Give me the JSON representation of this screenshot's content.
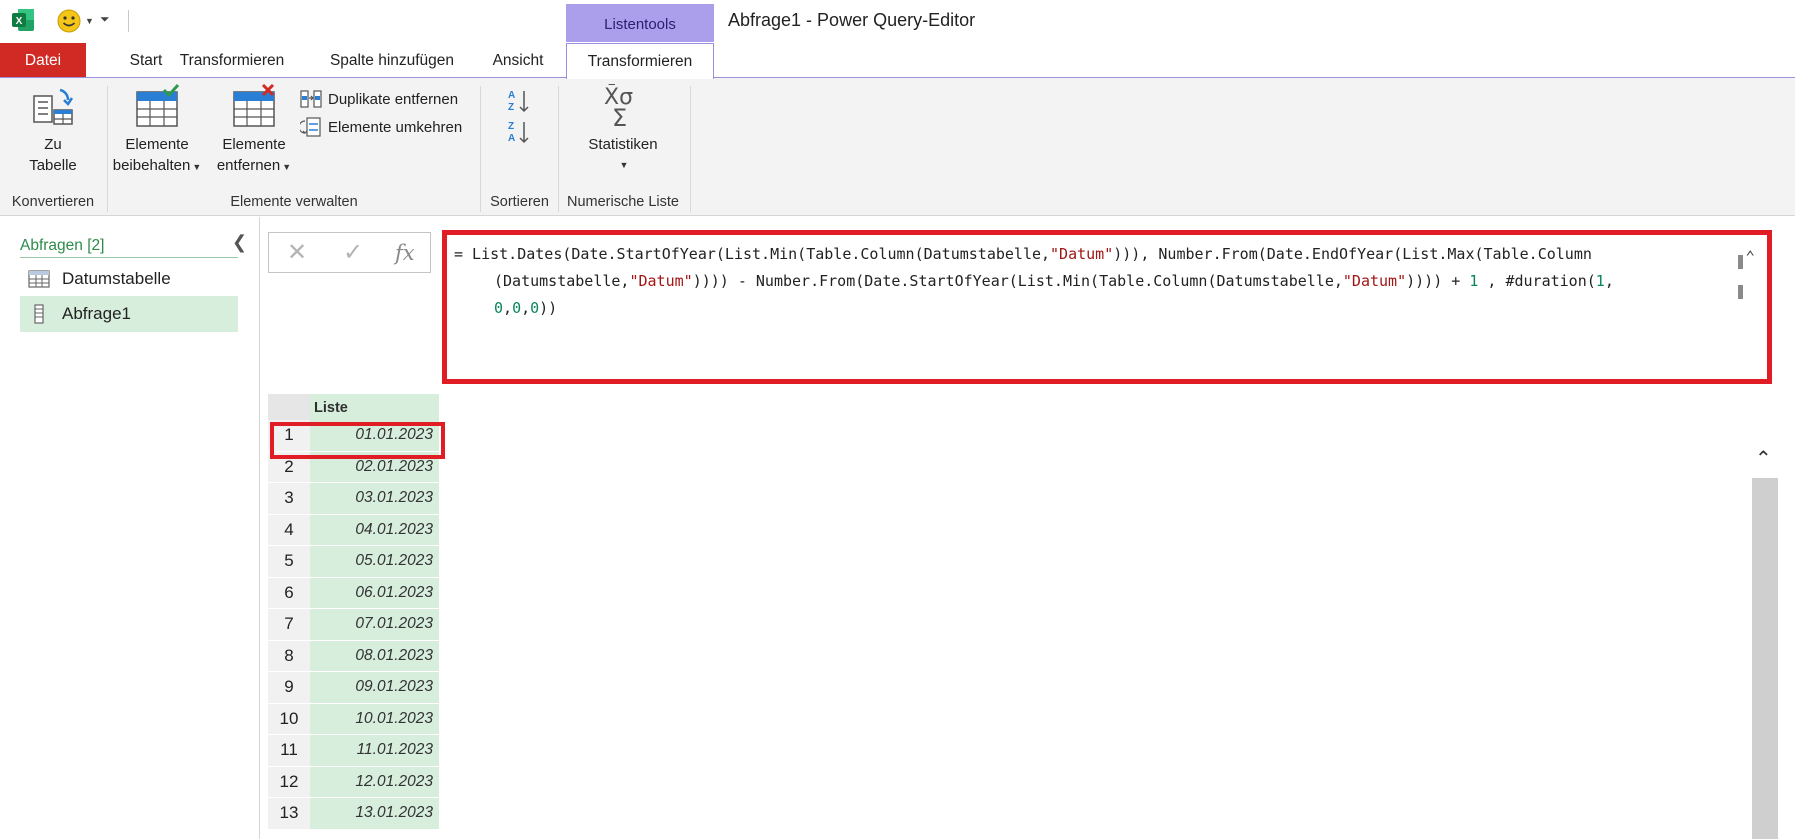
{
  "window": {
    "title": "Abfrage1 - Power Query-Editor",
    "context_group": "Listentools",
    "context_color": "#ab9eea"
  },
  "tabs": [
    {
      "label": "Datei"
    },
    {
      "label": "Start"
    },
    {
      "label": "Transformieren"
    },
    {
      "label": "Spalte hinzufügen"
    },
    {
      "label": "Ansicht"
    },
    {
      "label": "Transformieren"
    }
  ],
  "ribbon": {
    "convert": {
      "to_table_line1": "Zu",
      "to_table_line2": "Tabelle",
      "label": "Konvertieren"
    },
    "manage": {
      "keep_line1": "Elemente",
      "keep_line2": "beibehalten",
      "remove_line1": "Elemente",
      "remove_line2": "entfernen",
      "remove_duplicates": "Duplikate entfernen",
      "reverse_items": "Elemente umkehren",
      "label": "Elemente verwalten"
    },
    "sort": {
      "label": "Sortieren"
    },
    "numeric": {
      "statistics": "Statistiken",
      "label": "Numerische Liste"
    }
  },
  "queries": {
    "header": "Abfragen [2]",
    "items": [
      {
        "label": "Datumstabelle"
      },
      {
        "label": "Abfrage1"
      }
    ]
  },
  "formula": {
    "fx_label": "fx",
    "line1_a": "= List.Dates(Date.StartOfYear(List.Min(Table.Column(Datumstabelle,",
    "line1_str": "\"Datum\"",
    "line1_b": "))), Number.From(Date.EndOfYear(List.Max(Table.Column",
    "line2_a": "(Datumstabelle,",
    "line2_str1": "\"Datum\"",
    "line2_b": ")))) - Number.From(Date.StartOfYear(List.Min(Table.Column(Datumstabelle,",
    "line2_str2": "\"Datum\"",
    "line2_c": ")))) + ",
    "line2_num": "1",
    "line2_d": " , #duration(",
    "line2_num2": "1",
    "line2_e": ",",
    "line3_num1": "0",
    "line3_sep1": ",",
    "line3_num2": "0",
    "line3_sep2": ",",
    "line3_num3": "0",
    "line3_end": "))"
  },
  "grid": {
    "column_header": "Liste",
    "rows": [
      {
        "n": "1",
        "v": "01.01.2023"
      },
      {
        "n": "2",
        "v": "02.01.2023"
      },
      {
        "n": "3",
        "v": "03.01.2023"
      },
      {
        "n": "4",
        "v": "04.01.2023"
      },
      {
        "n": "5",
        "v": "05.01.2023"
      },
      {
        "n": "6",
        "v": "06.01.2023"
      },
      {
        "n": "7",
        "v": "07.01.2023"
      },
      {
        "n": "8",
        "v": "08.01.2023"
      },
      {
        "n": "9",
        "v": "09.01.2023"
      },
      {
        "n": "10",
        "v": "10.01.2023"
      },
      {
        "n": "11",
        "v": "11.01.2023"
      },
      {
        "n": "12",
        "v": "12.01.2023"
      },
      {
        "n": "13",
        "v": "13.01.2023"
      }
    ]
  },
  "colors": {
    "file_tab": "#d12a24",
    "highlight": "#e01c24",
    "accent_green": "#2d8a4a",
    "cell_fill": "#d7eedd"
  }
}
